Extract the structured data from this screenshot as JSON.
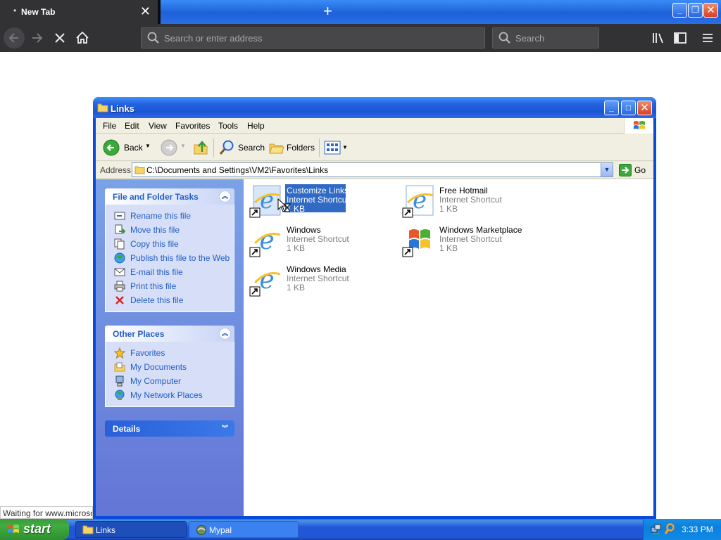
{
  "browser": {
    "tab_title": "New Tab",
    "tab_close_glyph": "✕",
    "new_tab_glyph": "+",
    "url_placeholder": "Search or enter address",
    "search_placeholder": "Search",
    "status_text": "Waiting for www.microsoft.com..."
  },
  "window": {
    "title": "Links",
    "menu": [
      "File",
      "Edit",
      "View",
      "Favorites",
      "Tools",
      "Help"
    ],
    "toolbar": {
      "back": "Back",
      "search": "Search",
      "folders": "Folders"
    },
    "address": {
      "label": "Address",
      "value": "C:\\Documents and Settings\\VM2\\Favorites\\Links",
      "go": "Go"
    }
  },
  "taskpane": {
    "file_tasks": {
      "title": "File and Folder Tasks",
      "items": [
        "Rename this file",
        "Move this file",
        "Copy this file",
        "Publish this file to the Web",
        "E-mail this file",
        "Print this file",
        "Delete this file"
      ]
    },
    "other_places": {
      "title": "Other Places",
      "items": [
        "Favorites",
        "My Documents",
        "My Computer",
        "My Network Places"
      ]
    },
    "details": {
      "title": "Details"
    }
  },
  "files": [
    {
      "name": "Customize Links",
      "type": "Internet Shortcut",
      "size": "1 KB",
      "icon": "ie-shortcut-icon",
      "selected": true
    },
    {
      "name": "Free Hotmail",
      "type": "Internet Shortcut",
      "size": "1 KB",
      "icon": "ie-shortcut-icon",
      "selected": false
    },
    {
      "name": "Windows",
      "type": "Internet Shortcut",
      "size": "1 KB",
      "icon": "ie-shortcut-icon",
      "selected": false
    },
    {
      "name": "Windows Marketplace",
      "type": "Internet Shortcut",
      "size": "1 KB",
      "icon": "windows-flag-shortcut-icon",
      "selected": false
    },
    {
      "name": "Windows Media",
      "type": "Internet Shortcut",
      "size": "1 KB",
      "icon": "ie-shortcut-icon",
      "selected": false
    }
  ],
  "taskbar": {
    "start": "start",
    "tasks": [
      {
        "label": "Links",
        "active": true
      },
      {
        "label": "Mypal",
        "active": false
      }
    ],
    "clock": "3:33 PM"
  },
  "colors": {
    "xp_blue": "#0a4cd8",
    "selection": "#316ac5",
    "taskpane_link": "#215dc6",
    "start_green": "#3fae3f"
  }
}
